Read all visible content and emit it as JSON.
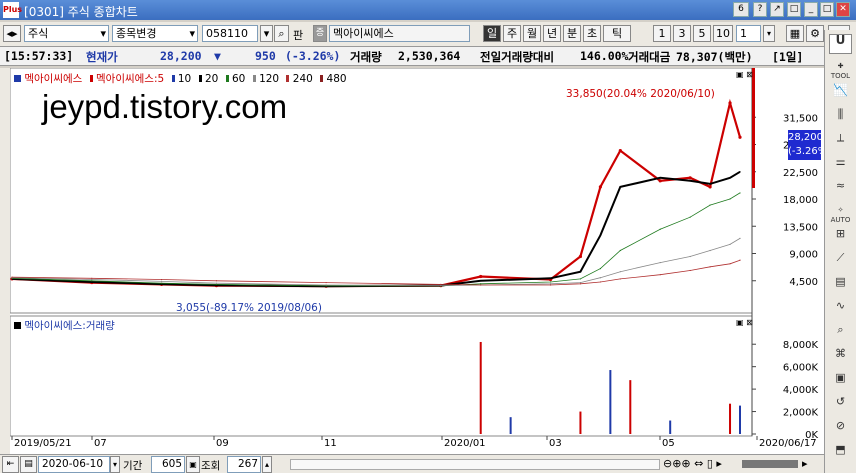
{
  "window": {
    "code": "0301",
    "app": "주식",
    "title": "종합차트",
    "logo": "Plus",
    "page_num": "6"
  },
  "toolbar": {
    "market": "주식",
    "mode": "종목변경",
    "code": "058110",
    "pan": "판",
    "badge": "증",
    "name": "멕아이씨에스",
    "periods": [
      "일",
      "주",
      "월",
      "년",
      "분",
      "초",
      "틱"
    ],
    "active_period": "일",
    "nums": [
      "1",
      "3",
      "5",
      "10"
    ],
    "count": "1"
  },
  "info": {
    "time": "[15:57:33]",
    "price_label": "현재가",
    "price": "28,200",
    "arrow": "▼",
    "change": "950",
    "change_pct": "(-3.26%)",
    "vol_label": "거래량",
    "volume": "2,530,364",
    "prev_label": "전일거래량대비",
    "prev_ratio": "146.00%",
    "amt_label": "거래대금",
    "amount": "78,307(백만)",
    "period_tag": "[1일]"
  },
  "legend": {
    "items": [
      {
        "text": "멕아이씨에스",
        "color": "#cc0000",
        "swatch": "#1f3aa8"
      },
      {
        "text": "멕아이씨에스:5",
        "color": "#cc0000",
        "swatch": "#cc0000"
      },
      {
        "text": "10",
        "color": "#1f3aa8",
        "swatch": "#1f3aa8"
      },
      {
        "text": "20",
        "color": "#000000",
        "swatch": "#000000"
      },
      {
        "text": "60",
        "color": "#1e7a1e",
        "swatch": "#1e7a1e"
      },
      {
        "text": "120",
        "color": "#888888",
        "swatch": "#888888"
      },
      {
        "text": "240",
        "color": "#b03030",
        "swatch": "#b03030"
      },
      {
        "text": "480",
        "color": "#8a2020",
        "swatch": "#8a2020"
      }
    ]
  },
  "watermark": "jeypd.tistory.com",
  "side_tag": "호",
  "price_box": {
    "price": "28,200",
    "pct": "(-3.26%)"
  },
  "max_note": "33,850(20.04% 2020/06/10)",
  "min_note": "3,055(-89.17% 2019/08/06)",
  "vol_legend": "멕아이씨에스:거래량",
  "dates": [
    "2019/05/21",
    "07",
    "09",
    "11",
    "2020/01",
    "03",
    "05",
    "2020/06/17"
  ],
  "bottom": {
    "date": "2020-06-10",
    "period_label": "기간",
    "period": "605",
    "query": "조회",
    "count": "267"
  },
  "right_tools": [
    "TOOL",
    "",
    "",
    "",
    "",
    "AUTO",
    "",
    "",
    "",
    "",
    "",
    "",
    "",
    "",
    "",
    ""
  ],
  "chart_data": [
    {
      "type": "line",
      "title": "멕아이씨에스",
      "ylim": [
        0,
        36000
      ],
      "yticks": [
        4500,
        9000,
        13500,
        18000,
        22500,
        27000,
        31500
      ],
      "series": [
        {
          "name": "멕아이씨에스",
          "note": "daily close (approx)",
          "x": [
            "2019/05/21",
            "2019/07",
            "2019/08/06",
            "2019/09",
            "2019/11",
            "2020/01",
            "2020/02",
            "2020/03",
            "2020/03/20",
            "2020/04/01",
            "2020/04/15",
            "2020/05",
            "2020/05/20",
            "2020/06/01",
            "2020/06/10",
            "2020/06/17"
          ],
          "values": [
            4800,
            4200,
            3900,
            3700,
            3600,
            3700,
            5200,
            4700,
            8500,
            20000,
            26000,
            21000,
            21500,
            20000,
            33850,
            28200
          ]
        },
        {
          "name": "20",
          "values": [
            4800,
            4300,
            3950,
            3750,
            3600,
            3700,
            4500,
            4900,
            6000,
            12000,
            20000,
            21500,
            21000,
            20500,
            21500,
            22500
          ]
        },
        {
          "name": "60",
          "values": [
            4900,
            4500,
            4100,
            3900,
            3650,
            3650,
            4000,
            4300,
            4800,
            6500,
            9500,
            13000,
            15000,
            17000,
            18000,
            19000
          ]
        },
        {
          "name": "120",
          "values": [
            5000,
            4700,
            4400,
            4100,
            3800,
            3700,
            3800,
            4000,
            4200,
            5000,
            6000,
            7500,
            8500,
            9500,
            10500,
            11500
          ]
        },
        {
          "name": "240",
          "values": [
            5100,
            4900,
            4700,
            4500,
            4200,
            3900,
            3800,
            3800,
            4000,
            4300,
            4800,
            5500,
            6200,
            6800,
            7300,
            7900
          ]
        }
      ]
    },
    {
      "type": "bar",
      "title": "멕아이씨에스:거래량",
      "ylim": [
        0,
        9000000
      ],
      "yticks": [
        "8,000K",
        "6,000K",
        "4,000K",
        "2,000K",
        "0K"
      ],
      "note": "daily volume bars (approx)",
      "x": [
        "2020/01/29",
        "2020/02",
        "2020/03/25",
        "2020/04/06",
        "2020/04/20",
        "2020/05/15",
        "2020/06/10",
        "2020/06/17"
      ],
      "values": [
        8200000,
        1500000,
        2000000,
        5700000,
        4800000,
        1200000,
        2700000,
        2530364
      ]
    }
  ]
}
